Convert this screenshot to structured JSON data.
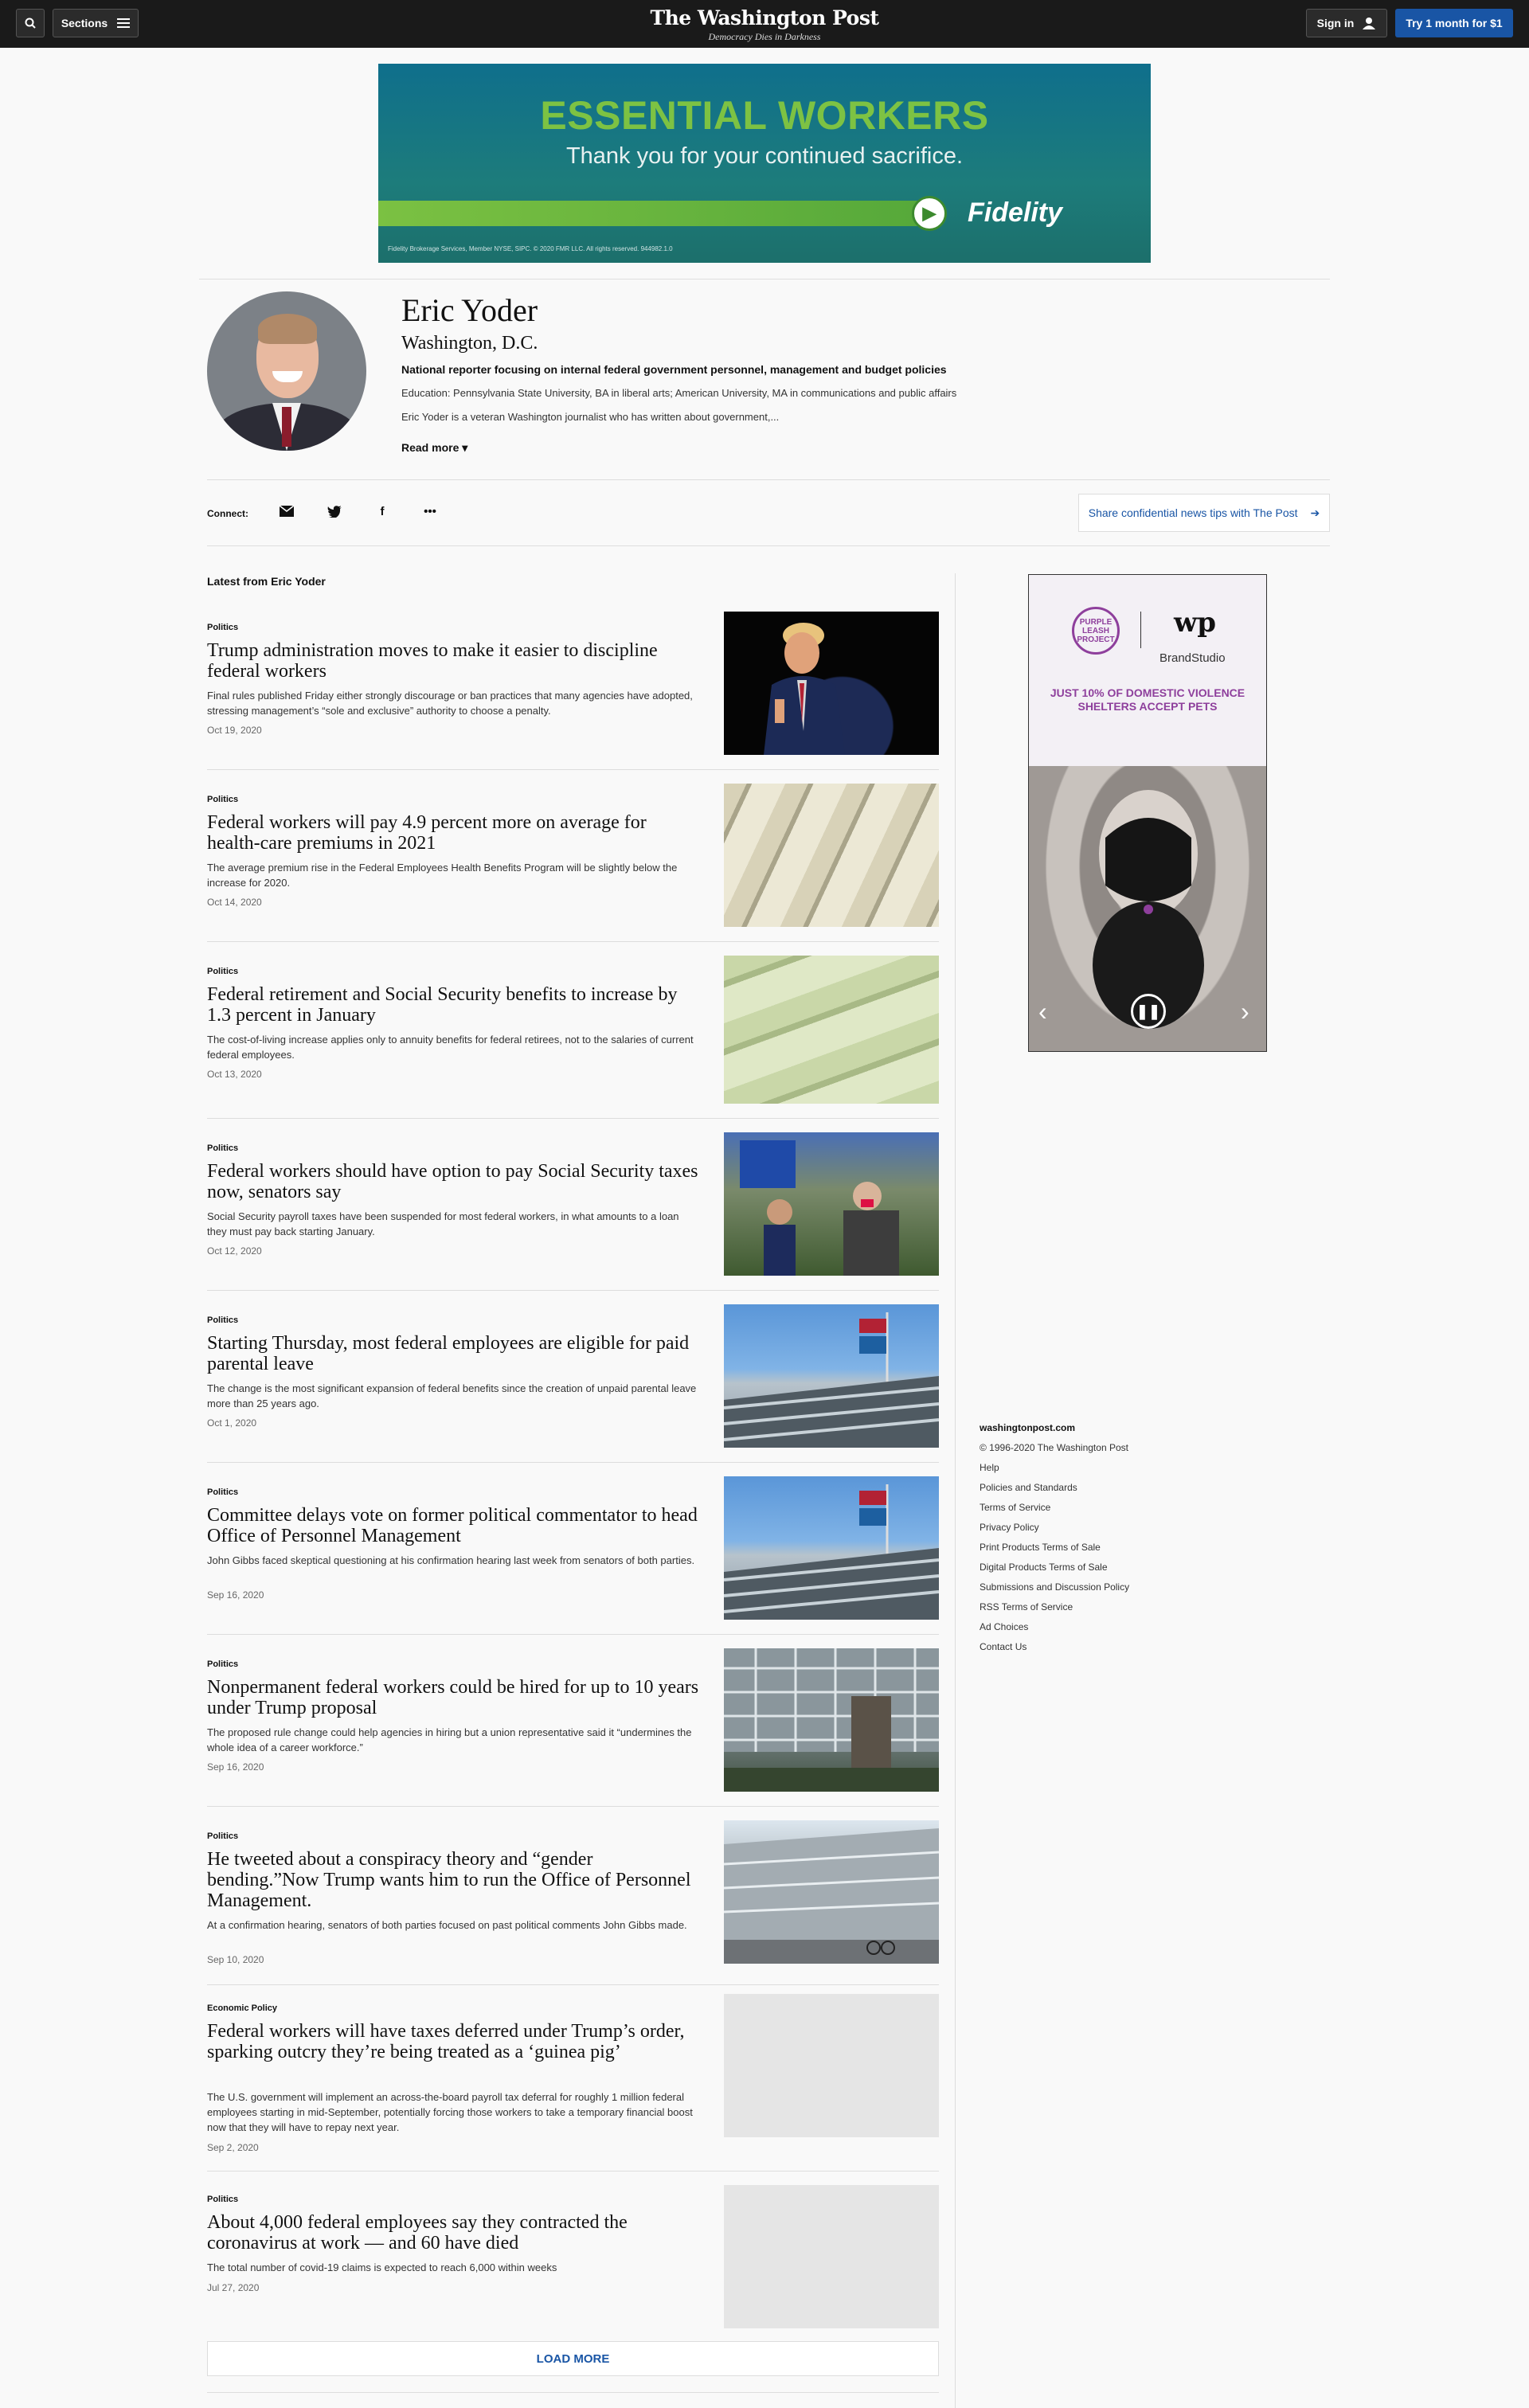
{
  "nav": {
    "sections_label": "Sections",
    "logo": "The Washington Post",
    "tagline": "Democracy Dies in Darkness",
    "signin_label": "Sign in",
    "try_label": "Try 1 month for $1"
  },
  "ad_banner": {
    "headline": "ESSENTIAL WORKERS",
    "subhead": "Thank you for your continued sacrifice.",
    "brand": "Fidelity",
    "fineprint": "Fidelity Brokerage Services, Member NYSE, SIPC. © 2020 FMR LLC. All rights reserved. 944982.1.0"
  },
  "profile": {
    "name": "Eric Yoder",
    "location": "Washington, D.C.",
    "focus": "National reporter focusing on internal federal government personnel, management and budget policies",
    "education": "Education: Pennsylvania State University, BA in liberal arts; American University, MA in communications and public affairs",
    "bio": "Eric Yoder is a veteran Washington journalist who has written about government,...",
    "read_more": "Read more ▾"
  },
  "connect": {
    "label": "Connect:",
    "icons": [
      "email-icon",
      "twitter-icon",
      "facebook-icon",
      "more-icon"
    ],
    "tips_label": "Share confidential news tips with The Post"
  },
  "feed": {
    "title": "Latest from Eric Yoder",
    "articles": [
      {
        "kicker": "Politics",
        "headline": "Trump administration moves to make it easier to discipline federal workers",
        "blurb": "Final rules published Friday either strongly discourage or ban practices that many agencies have adopted, stressing management’s “sole and exclusive” authority to choose a penalty.",
        "date": "Oct 19, 2020"
      },
      {
        "kicker": "Politics",
        "headline": "Federal workers will pay 4.9 percent more on average for health-care premiums in 2021",
        "blurb": "The average premium rise in the Federal Employees Health Benefits Program will be slightly below the increase for 2020.",
        "date": "Oct 14, 2020"
      },
      {
        "kicker": "Politics",
        "headline": "Federal retirement and Social Security benefits to increase by 1.3 percent in January",
        "blurb": "The cost-of-living increase applies only to annuity benefits for federal retirees, not to the salaries of current federal employees.",
        "date": "Oct 13, 2020"
      },
      {
        "kicker": "Politics",
        "headline": "Federal workers should have option to pay Social Security taxes now, senators say",
        "blurb": "Social Security payroll taxes have been suspended for most federal workers, in what amounts to a loan they must pay back starting January.",
        "date": "Oct 12, 2020"
      },
      {
        "kicker": "Politics",
        "headline": "Starting Thursday, most federal employees are eligible for paid parental leave",
        "blurb": "The change is the most significant expansion of federal benefits since the creation of unpaid parental leave more than 25 years ago.",
        "date": "Oct 1, 2020"
      },
      {
        "kicker": "Politics",
        "headline": "Committee delays vote on former political commentator to head Office of Personnel Management",
        "blurb": "John Gibbs faced skeptical questioning at his confirmation hearing last week from senators of both parties.",
        "date": "Sep 16, 2020"
      },
      {
        "kicker": "Politics",
        "headline": "Nonpermanent federal workers could be hired for up to 10 years under Trump proposal",
        "blurb": "The proposed rule change could help agencies in hiring but a union representative said it “undermines the whole idea of a career workforce.”",
        "date": "Sep 16, 2020"
      },
      {
        "kicker": "Politics",
        "headline": "He tweeted about a conspiracy theory and “gender bending.”Now Trump wants him to run the Office of Personnel Management.",
        "blurb": "At a confirmation hearing, senators of both parties focused on past political comments John Gibbs made.",
        "date": "Sep 10, 2020"
      },
      {
        "kicker": "Economic Policy",
        "headline": "Federal workers will have taxes deferred under Trump’s order, sparking outcry they’re being treated as a ‘guinea pig’",
        "blurb": "The U.S. government will implement an across-the-board payroll tax deferral for roughly 1 million federal employees starting in mid-September, potentially forcing those workers to take a temporary financial boost now that they will have to repay next year.",
        "date": "Sep 2, 2020"
      },
      {
        "kicker": "Politics",
        "headline": "About 4,000 federal employees say they contracted the coronavirus at work — and 60 have died",
        "blurb": "The total number of covid-19 claims is expected to reach 6,000 within weeks",
        "date": "Jul 27, 2020"
      }
    ],
    "load_more": "LOAD MORE"
  },
  "side_ad": {
    "org": "PURPLE LEASH PROJECT",
    "logo": "wp",
    "studio": "BrandStudio",
    "message": "JUST 10% OF DOMESTIC VIOLENCE SHELTERS ACCEPT PETS"
  },
  "footer": {
    "site": "washingtonpost.com",
    "links": [
      "© 1996-2020 The Washington Post",
      "Help",
      "Policies and Standards",
      "Terms of Service",
      "Privacy Policy",
      "Print Products Terms of Sale",
      "Digital Products Terms of Sale",
      "Submissions and Discussion Policy",
      "RSS Terms of Service",
      "Ad Choices",
      "Contact Us"
    ]
  }
}
